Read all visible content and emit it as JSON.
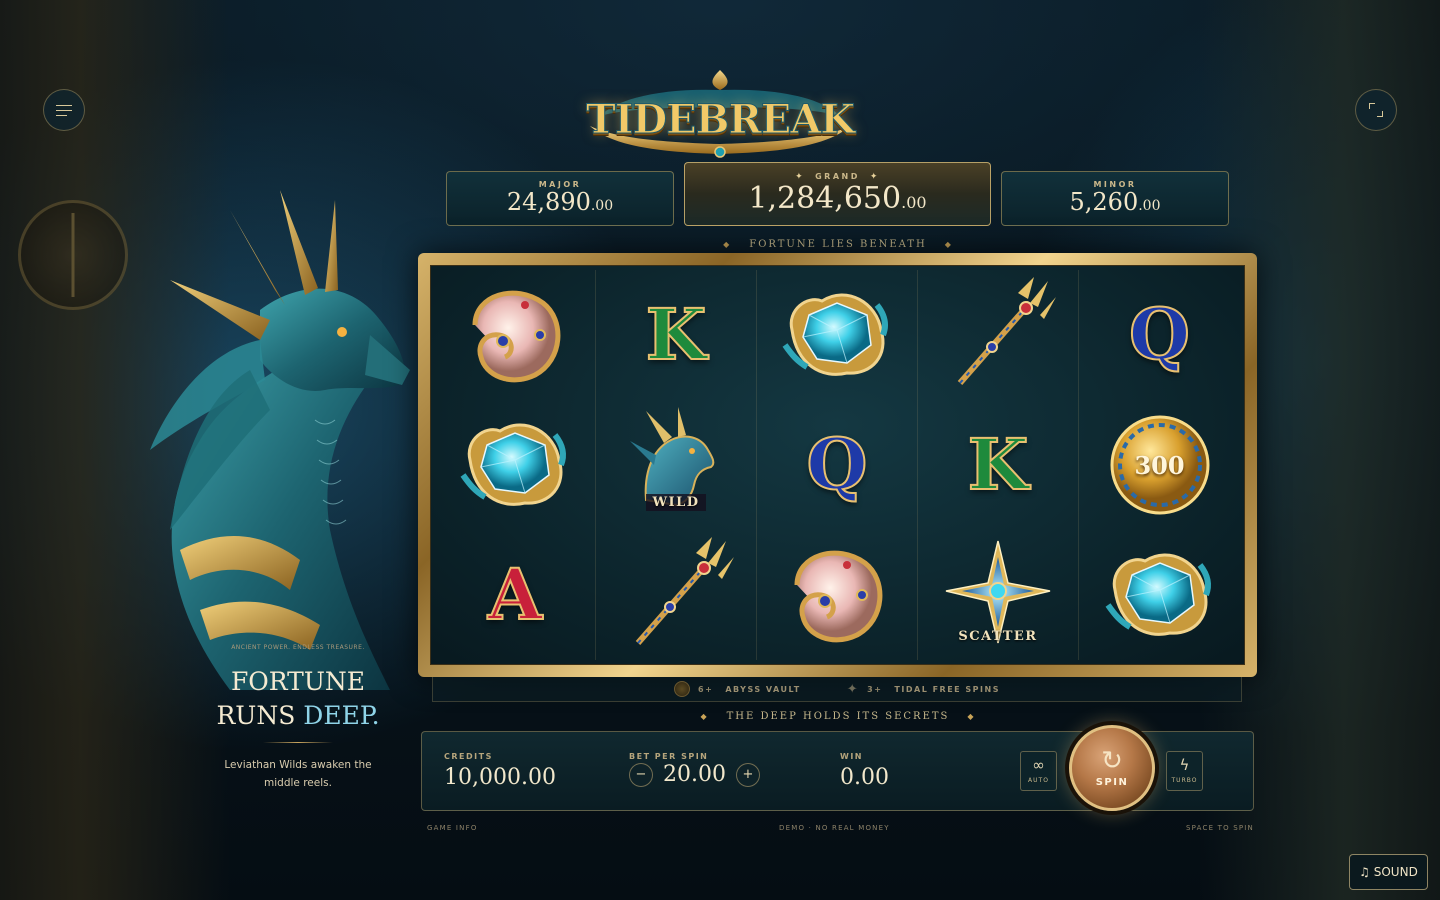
{
  "game": {
    "logo_text": "TIDEBREAK"
  },
  "jackpots": {
    "major": {
      "label": "MAJOR",
      "value": "24,890",
      "cents": ".00"
    },
    "grand": {
      "label": "GRAND",
      "value": "1,284,650",
      "cents": ".00"
    },
    "minor": {
      "label": "MINOR",
      "value": "5,260",
      "cents": ".00"
    }
  },
  "taglines": {
    "top": "FORTUNE LIES BENEATH",
    "bottom": "THE DEEP HOLDS ITS SECRETS"
  },
  "reels": [
    [
      {
        "symbol": "nautilus-shell"
      },
      {
        "symbol": "aquamarine-gem"
      },
      {
        "symbol": "letter-a",
        "text": "A"
      }
    ],
    [
      {
        "symbol": "letter-k",
        "text": "K"
      },
      {
        "symbol": "wild-dragon",
        "label": "WILD"
      },
      {
        "symbol": "trident"
      }
    ],
    [
      {
        "symbol": "aquamarine-gem"
      },
      {
        "symbol": "letter-q",
        "text": "Q"
      },
      {
        "symbol": "nautilus-shell"
      }
    ],
    [
      {
        "symbol": "trident"
      },
      {
        "symbol": "letter-k",
        "text": "K"
      },
      {
        "symbol": "scatter-star",
        "label": "SCATTER"
      }
    ],
    [
      {
        "symbol": "letter-q",
        "text": "Q"
      },
      {
        "symbol": "gold-coin",
        "text": "300"
      },
      {
        "symbol": "aquamarine-gem"
      }
    ]
  ],
  "features": {
    "vault": {
      "count": "6+",
      "label": "ABYSS VAULT"
    },
    "free_spins": {
      "count": "3+",
      "label": "TIDAL FREE SPINS"
    }
  },
  "controls": {
    "credits_label": "CREDITS",
    "credits_value": "10,000.00",
    "bet_label": "BET PER SPIN",
    "bet_value": "20.00",
    "bet_minus": "−",
    "bet_plus": "+",
    "win_label": "WIN",
    "win_value": "0.00",
    "auto_label": "AUTO",
    "auto_glyph": "∞",
    "spin_label": "SPIN",
    "spin_glyph": "↻",
    "turbo_label": "TURBO",
    "turbo_glyph": "ϟ"
  },
  "footer": {
    "game_info": "GAME INFO",
    "demo": "DEMO · NO REAL MONEY",
    "space": "SPACE TO SPIN"
  },
  "promo": {
    "kicker": "ANCIENT POWER. ENDLESS TREASURE.",
    "title_line1": "FORTUNE",
    "title_line2_a": "RUNS ",
    "title_line2_b": "DEEP.",
    "body": "Leviathan Wilds awaken the middle reels."
  },
  "sound_button": "♫ SOUND",
  "icons": {
    "menu": "hamburger-icon",
    "fullscreen": "fullscreen-icon"
  },
  "colors": {
    "gold": "#d6b36a",
    "teal_bg": "#0b2229",
    "accent_cyan": "#8fd4e8",
    "spin_copper": "#b57848"
  }
}
